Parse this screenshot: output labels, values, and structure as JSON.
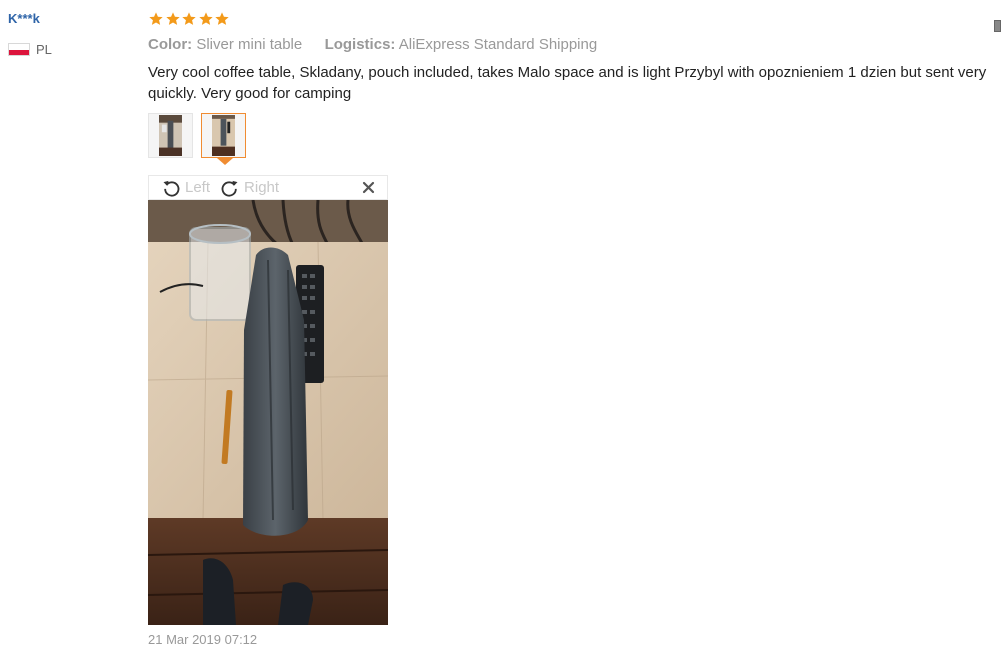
{
  "reviewer": {
    "name": "K***k",
    "country_code": "PL",
    "flag_colors": [
      "#ffffff",
      "#dc143c"
    ]
  },
  "rating": {
    "stars": 5,
    "max": 5,
    "color": "#f39a1a"
  },
  "meta": {
    "color_label": "Color:",
    "color_value": "Sliver mini table",
    "logistics_label": "Logistics:",
    "logistics_value": "AliExpress Standard Shipping"
  },
  "review_text": "Very cool coffee table, Skladany, pouch included, takes Malo space and is light Przybyl with opoznieniem 1 dzien but sent very quickly. Very good for camping",
  "thumbnails": [
    {
      "icon": "review-photo-thumbnail",
      "selected": false
    },
    {
      "icon": "review-photo-thumbnail",
      "selected": true,
      "border_color": "#f08c32"
    }
  ],
  "viewer": {
    "rotate_left_label": "Left",
    "rotate_right_label": "Right",
    "close_icon": "close-icon"
  },
  "date_text": "21 Mar 2019 07:12"
}
